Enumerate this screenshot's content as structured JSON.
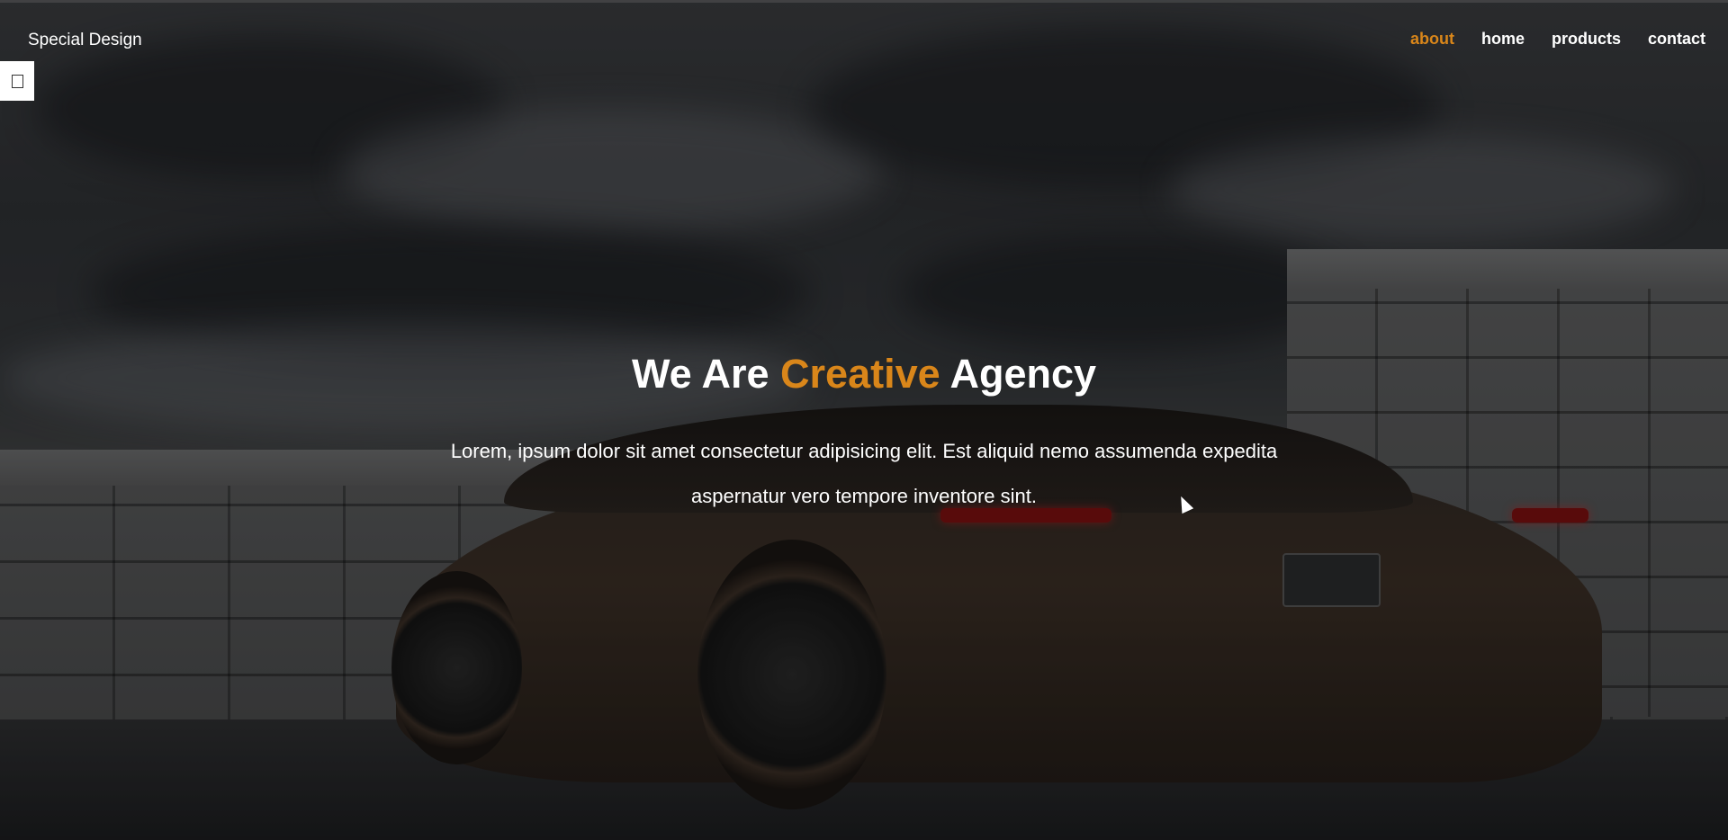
{
  "brand": {
    "logo_text": "Special Design"
  },
  "nav": {
    "items": [
      {
        "label": "about",
        "active": true
      },
      {
        "label": "home",
        "active": false
      },
      {
        "label": "products",
        "active": false
      },
      {
        "label": "contact",
        "active": false
      }
    ]
  },
  "menu_toggle": {
    "icon": "square-icon"
  },
  "hero": {
    "headline_part1": "We Are ",
    "headline_accent": "Creative",
    "headline_part2": " Agency",
    "description": "Lorem, ipsum dolor sit amet consectetur adipisicing elit. Est aliquid nemo assumenda expedita aspernatur vero tempore inventore sint."
  },
  "colors": {
    "accent": "#d9861a",
    "text": "#ffffff"
  }
}
